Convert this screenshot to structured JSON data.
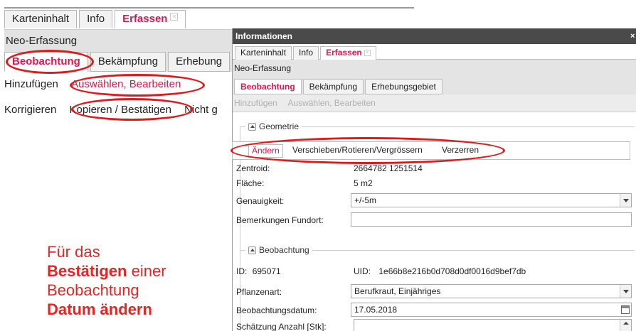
{
  "background": {
    "tabs": [
      "Karteninhalt",
      "Info",
      "Erfassen"
    ],
    "subheader": "Neo-Erfassung",
    "subtabs": [
      "Beobachtung",
      "Bekämpfung",
      "Erhebung"
    ],
    "row1": [
      "Hinzufügen",
      "Auswählen, Bearbeiten"
    ],
    "row2": [
      "Korrigieren",
      "Kopieren / Bestätigen",
      "Nicht g"
    ]
  },
  "dialog": {
    "title": "Informationen",
    "close_icon": "×",
    "tabs": [
      "Karteninhalt",
      "Info",
      "Erfassen"
    ],
    "subheader": "Neo-Erfassung",
    "subtabs": [
      "Beobachtung",
      "Bekämpfung",
      "Erhebungsgebiet"
    ],
    "toolbar": [
      "Hinzufügen",
      "Auswählen, Bearbeiten"
    ],
    "geometrie": {
      "legend": "Geometrie",
      "buttons": [
        "Ändern",
        "Verschieben/Rotieren/Vergrössern",
        "Verzerren"
      ],
      "zentroid_label": "Zentroid:",
      "zentroid_value": "2664782 1251514",
      "flaeche_label": "Fläche:",
      "flaeche_value": "5 m2",
      "genauigkeit_label": "Genauigkeit:",
      "genauigkeit_value": "+/-5m",
      "bemerkungen_label": "Bemerkungen Fundort:",
      "bemerkungen_value": ""
    },
    "beobachtung": {
      "legend": "Beobachtung",
      "id_label": "ID:",
      "id_value": "695071",
      "uid_label": "UID:",
      "uid_value": "1e66b8e216b0d708d0df0016d9bef7db",
      "pflanzenart_label": "Pflanzenart:",
      "pflanzenart_value": "Berufkraut, Einjähriges",
      "datum_label": "Beobachtungsdatum:",
      "datum_value": "17.05.2018",
      "anzahl_label": "Schätzung Anzahl [Stk]:",
      "anzahl_value": ""
    }
  },
  "annotation": {
    "line1": "Für das",
    "line2_bold": "Bestätigen",
    "line2_rest": " einer",
    "line3": "Beobachtung",
    "line4_bold": "Datum ändern"
  },
  "colors": {
    "accent": "#d8194f",
    "highlight": "#e01a1a",
    "annotation": "#e52521"
  }
}
